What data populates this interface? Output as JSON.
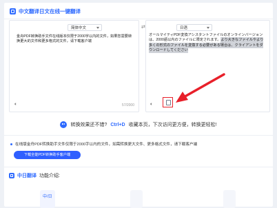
{
  "header": {
    "title": "中文翻译日文在线一键翻译"
  },
  "source_panel": {
    "language": "简体中文",
    "text": "金舟PDF转换助手文件在线版本仅限于2000字以内的文件，如果您需要转换更大的文件和更多格式的文件，请下载客户端",
    "counter": "57/2000"
  },
  "target_panel": {
    "language": "日语",
    "text_lead": "オールマイティPDF変換アシスタントファイルのオンラインバージョンは、2000語以内のファイルに限定されます。",
    "text_highlight": "より大きなファイルやより多くの形式のファイルを変換する必要がある場合は、クライアントをダウンロードしてください"
  },
  "tip": {
    "lead": "转换效果还不错?",
    "shortcut": "Ctrl+D",
    "tail": "收藏本页，下次访问更方便，转换更轻松!"
  },
  "notice": {
    "text": "在线版金舟PDF转换助手文件仅限于2000字以内的文件，如需转换更大文件、更多格式文件，请下载客户端",
    "button": "下载全能PDF转换助手客户端"
  },
  "features": {
    "title": "中日翻译",
    "subtitle": "功能介绍:",
    "icon_glyph": "中/日"
  },
  "colors": {
    "accent": "#2f6bff",
    "callout": "#e8202a"
  }
}
